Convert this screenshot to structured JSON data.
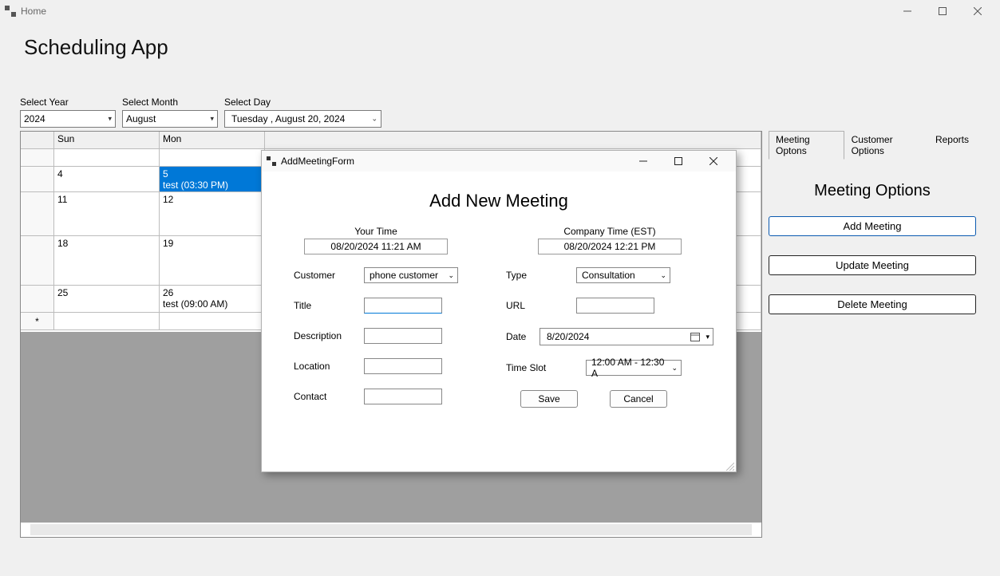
{
  "window": {
    "title": "Home"
  },
  "app": {
    "title": "Scheduling App"
  },
  "controls": {
    "year_label": "Select Year",
    "year_value": "2024",
    "month_label": "Select Month",
    "month_value": "August",
    "day_label": "Select Day",
    "day_value": "Tuesday  ,    August    20, 2024"
  },
  "calendar": {
    "headers": [
      "Sun",
      "Mon"
    ],
    "rows": [
      {
        "empty_header": true
      },
      {
        "indicator": "current",
        "sun": "4",
        "mon": "5",
        "mon_sub": "test (03:30 PM)",
        "selected": "mon"
      },
      {
        "sun": "11",
        "mon": "12"
      },
      {
        "sun": "18",
        "mon": "19"
      },
      {
        "sun": "25",
        "mon": "26",
        "mon_sub": "test (09:00 AM)"
      },
      {
        "indicator": "star"
      }
    ]
  },
  "side": {
    "tabs": [
      "Meeting Optons",
      "Customer Options",
      "Reports"
    ],
    "active_tab": 0,
    "title": "Meeting Options",
    "buttons": {
      "add": "Add Meeting",
      "update": "Update Meeting",
      "delete": "Delete Meeting"
    }
  },
  "modal": {
    "title": "AddMeetingForm",
    "heading": "Add New Meeting",
    "your_time_label": "Your Time",
    "your_time_value": "08/20/2024 11:21 AM",
    "company_time_label": "Company Time (EST)",
    "company_time_value": "08/20/2024 12:21 PM",
    "customer_label": "Customer",
    "customer_value": "phone customer",
    "title_label": "Title",
    "title_value": "",
    "description_label": "Description",
    "description_value": "",
    "location_label": "Location",
    "location_value": "",
    "contact_label": "Contact",
    "contact_value": "",
    "type_label": "Type",
    "type_value": "Consultation",
    "url_label": "URL",
    "url_value": "",
    "date_label": "Date",
    "date_value": "8/20/2024",
    "timeslot_label": "Time Slot",
    "timeslot_value": "12:00 AM - 12:30 A",
    "save": "Save",
    "cancel": "Cancel"
  }
}
